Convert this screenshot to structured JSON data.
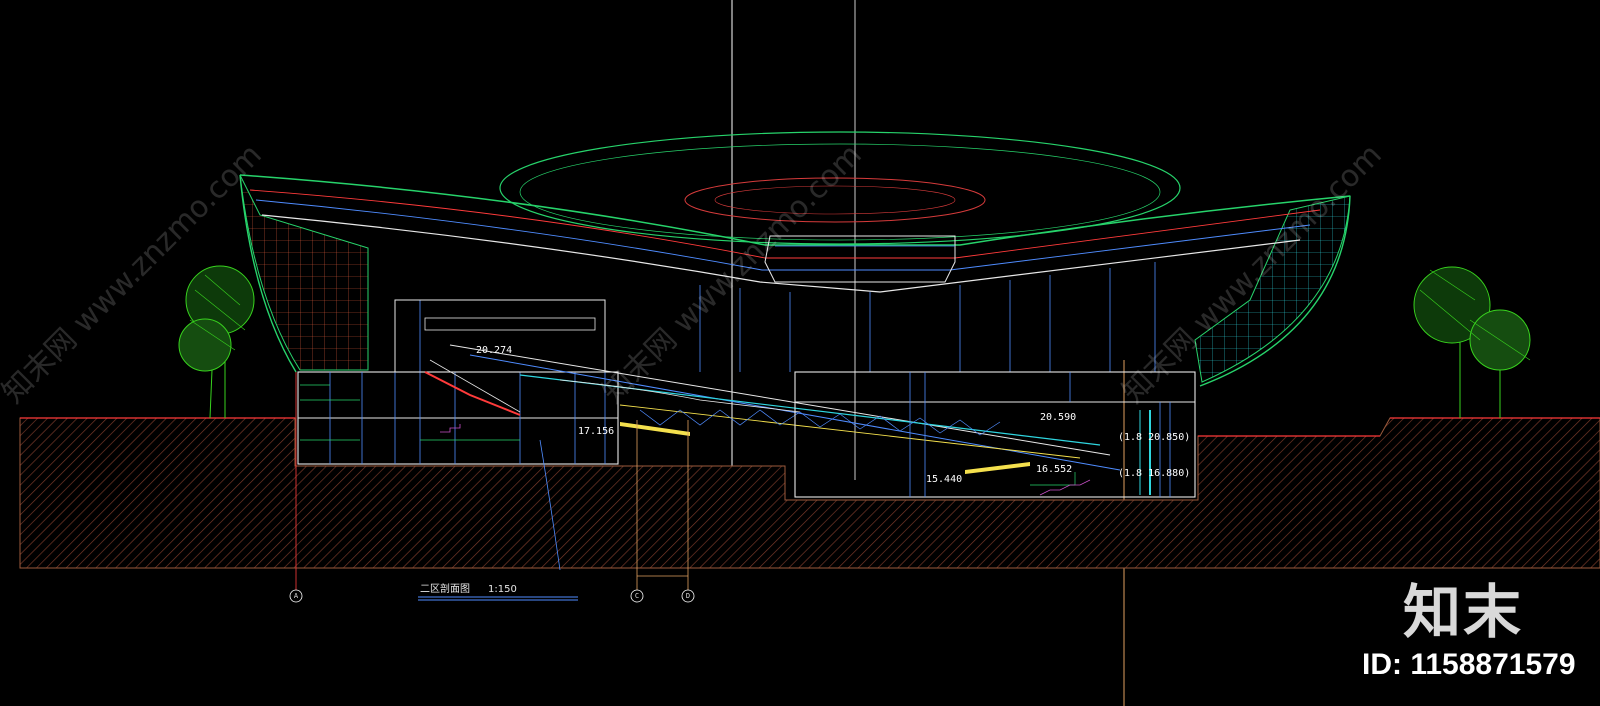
{
  "drawing": {
    "title": "二区剖面图",
    "scale": "1:150",
    "colors": {
      "background": "#000000",
      "ground_hatch": "#7a3a2a",
      "roof": "#27d36b",
      "structure": "#4f8cff",
      "section": "#ff3b3b",
      "wall": "#e8e8e8",
      "tree": "#38d21e",
      "cyan": "#2fd6e0",
      "yellow": "#f4e04d"
    },
    "levels": [
      {
        "label": "20.274"
      },
      {
        "label": "20.590"
      },
      {
        "label": "17.156"
      },
      {
        "label": "15.440"
      },
      {
        "label": "16.552"
      },
      {
        "label": "(1.8 20.850)"
      },
      {
        "label": "(1.8 16.880)"
      }
    ],
    "axes": [
      {
        "label": "A"
      },
      {
        "label": "C"
      },
      {
        "label": "D"
      }
    ]
  },
  "watermark": {
    "brand": "知末",
    "id_text": "ID: 1158871579",
    "diagonal": [
      {
        "text": "知末网 www.znzmo.com"
      },
      {
        "text": "知末网 www.znzmo.com"
      },
      {
        "text": "知末网 www.znzmo.com"
      }
    ]
  }
}
